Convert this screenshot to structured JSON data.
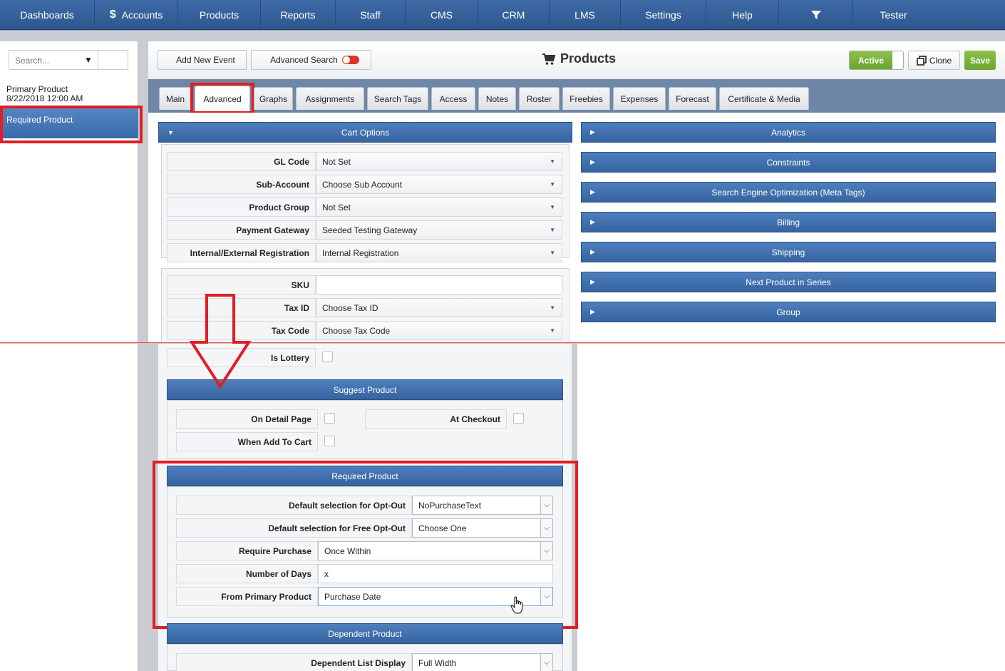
{
  "nav": {
    "items": [
      "Dashboards",
      "Accounts",
      "Products",
      "Reports",
      "Staff",
      "CMS",
      "CRM",
      "LMS",
      "Settings",
      "Help"
    ],
    "accounts_icon": "$",
    "user": "Tester"
  },
  "left": {
    "search_placeholder": "Search...",
    "primary_name": "Primary Product",
    "primary_date": "8/22/2018 12:00 AM",
    "selected": "Required Product"
  },
  "header": {
    "add_event": "Add New Event",
    "advanced_search": "Advanced Search",
    "title": "Products",
    "active": "Active",
    "clone": "Clone",
    "save": "Save"
  },
  "tabs": [
    "Main",
    "Advanced",
    "Graphs",
    "Assignments",
    "Search Tags",
    "Access",
    "Notes",
    "Roster",
    "Freebies",
    "Expenses",
    "Forecast",
    "Certificate & Media"
  ],
  "cart": {
    "title": "Cart Options",
    "rows": [
      {
        "label": "GL Code",
        "value": "Not Set"
      },
      {
        "label": "Sub-Account",
        "value": "Choose Sub Account"
      },
      {
        "label": "Product Group",
        "value": "Not Set"
      },
      {
        "label": "Payment Gateway",
        "value": "Seeded Testing Gateway"
      },
      {
        "label": "Internal/External Registration",
        "value": "Internal Registration"
      }
    ],
    "sku_label": "SKU",
    "sku_value": "",
    "tax_id_label": "Tax ID",
    "tax_id_value": "Choose Tax ID",
    "tax_code_label": "Tax Code",
    "tax_code_value": "Choose Tax Code",
    "lottery_label": "Is Lottery"
  },
  "suggest": {
    "title": "Suggest Product",
    "on_detail": "On Detail Page",
    "at_checkout": "At Checkout",
    "when_add": "When Add To Cart"
  },
  "required": {
    "title": "Required Product",
    "opt_out_label": "Default selection for Opt-Out",
    "opt_out_value": "NoPurchaseText",
    "free_opt_out_label": "Default selection for Free Opt-Out",
    "free_opt_out_value": "Choose One",
    "require_purchase_label": "Require Purchase",
    "require_purchase_value": "Once Within",
    "days_label": "Number of Days",
    "days_value": "x",
    "from_primary_label": "From Primary Product",
    "from_primary_value": "Purchase Date"
  },
  "dependent": {
    "title": "Dependent Product",
    "list_display_label": "Dependent List Display",
    "list_display_value": "Full Width"
  },
  "right_sections": [
    "Analytics",
    "Constraints",
    "Search Engine Optimization (Meta Tags)",
    "Billing",
    "Shipping",
    "Next Product in Series",
    "Group"
  ],
  "colors": {
    "accent": "#3a6aa8",
    "highlight": "#e21d24",
    "active": "#7ab23f"
  }
}
